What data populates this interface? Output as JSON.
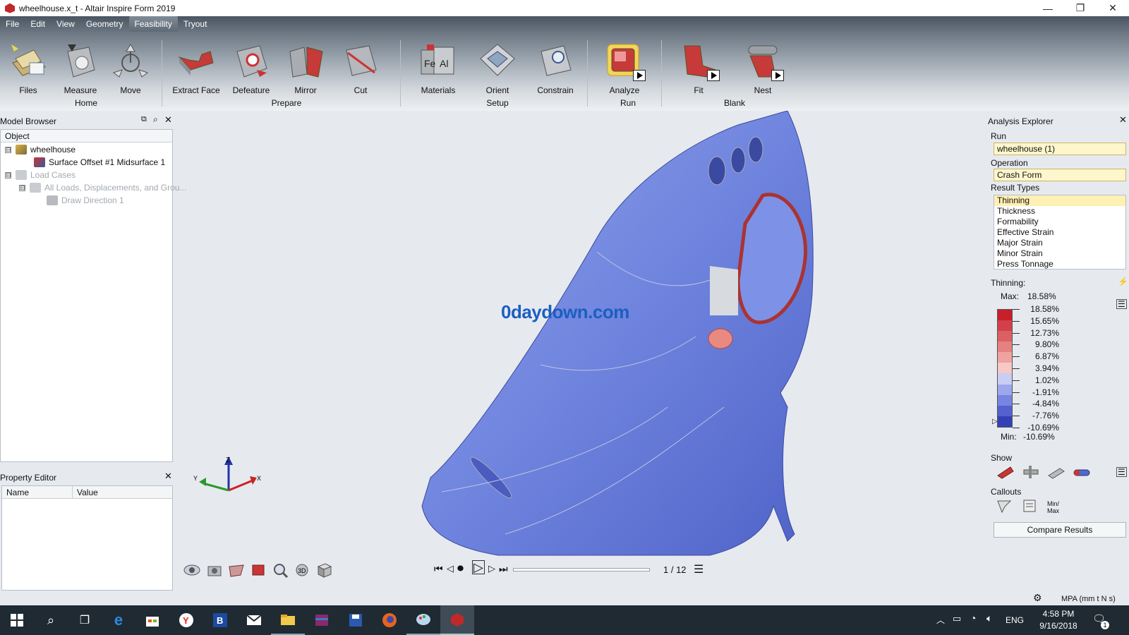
{
  "window": {
    "title": "wheelhouse.x_t - Altair Inspire Form 2019",
    "controls": [
      "minimize-icon",
      "restore-icon",
      "close-icon"
    ]
  },
  "menu": [
    "File",
    "Edit",
    "View",
    "Geometry",
    "Feasibility",
    "Tryout"
  ],
  "menu_active": "Feasibility",
  "ribbon": {
    "tools": [
      {
        "id": "files",
        "label": "Files",
        "icon": "files-icon"
      },
      {
        "id": "measure",
        "label": "Measure",
        "icon": "measure-icon"
      },
      {
        "id": "move",
        "label": "Move",
        "icon": "move-icon"
      },
      {
        "id": "extract",
        "label": "Extract Face",
        "icon": "extract-face-icon"
      },
      {
        "id": "defeature",
        "label": "Defeature",
        "icon": "defeature-icon"
      },
      {
        "id": "mirror",
        "label": "Mirror",
        "icon": "mirror-icon"
      },
      {
        "id": "cut",
        "label": "Cut",
        "icon": "cut-icon"
      },
      {
        "id": "materials",
        "label": "Materials",
        "icon": "materials-icon"
      },
      {
        "id": "orient",
        "label": "Orient",
        "icon": "orient-icon"
      },
      {
        "id": "constrain",
        "label": "Constrain",
        "icon": "constrain-icon"
      },
      {
        "id": "analyze",
        "label": "Analyze",
        "icon": "analyze-icon"
      },
      {
        "id": "fit",
        "label": "Fit",
        "icon": "fit-icon"
      },
      {
        "id": "nest",
        "label": "Nest",
        "icon": "nest-icon"
      }
    ],
    "groups": {
      "home": "Home",
      "prepare": "Prepare",
      "setup": "Setup",
      "run": "Run",
      "blank": "Blank"
    },
    "materials_glyphs": {
      "fe": "Fe",
      "al": "Al"
    }
  },
  "model_browser": {
    "title": "Model Browser",
    "column": "Object",
    "items": [
      {
        "label": "wheelhouse",
        "expander": "⊟"
      },
      {
        "label": "Surface Offset #1 Midsurface 1"
      },
      {
        "label": "Load Cases",
        "expander": "⊟"
      },
      {
        "label": "All Loads, Displacements, and Grou...",
        "expander": "⊟"
      },
      {
        "label": "Draw Direction 1"
      }
    ]
  },
  "property_editor": {
    "title": "Property Editor",
    "columns": [
      "Name",
      "Value"
    ]
  },
  "viewport": {
    "watermark": "0daydown.com",
    "axis_labels": {
      "z": "Z",
      "y": "Y",
      "x": "X"
    },
    "frame_counter": "1 / 12"
  },
  "analysis_explorer": {
    "title": "Analysis Explorer",
    "run_label": "Run",
    "run_value": "wheelhouse (1)",
    "operation_label": "Operation",
    "operation_value": "Crash Form",
    "result_types_label": "Result Types",
    "result_types": [
      "Thinning",
      "Thickness",
      "Formability",
      "Effective Strain",
      "Major Strain",
      "Minor Strain",
      "Press Tonnage"
    ],
    "selected_result": "Thinning",
    "legend_title": "Thinning:",
    "max_label": "Max:",
    "max_value": "18.58%",
    "min_label": "Min:",
    "min_value": "-10.69%",
    "legend_values": [
      "18.58%",
      "15.65%",
      "12.73%",
      "9.80%",
      "6.87%",
      "3.94%",
      "1.02%",
      "-1.91%",
      "-4.84%",
      "-7.76%",
      "-10.69%"
    ],
    "legend_colors": [
      "#c8202a",
      "#d3404a",
      "#dc5f64",
      "#e58181",
      "#eea3a1",
      "#f6c9c6",
      "#c9cdf4",
      "#9ea7ec",
      "#7784e0",
      "#5462cf",
      "#3441b6"
    ],
    "show_label": "Show",
    "callouts_label": "Callouts",
    "minmax_label": "Min/\nMax",
    "compare_button": "Compare Results"
  },
  "status": {
    "units": "MPA (mm t N s)"
  },
  "taskbar": {
    "lang": "ENG",
    "time": "4:58 PM",
    "date": "9/16/2018",
    "notifications": "1"
  }
}
